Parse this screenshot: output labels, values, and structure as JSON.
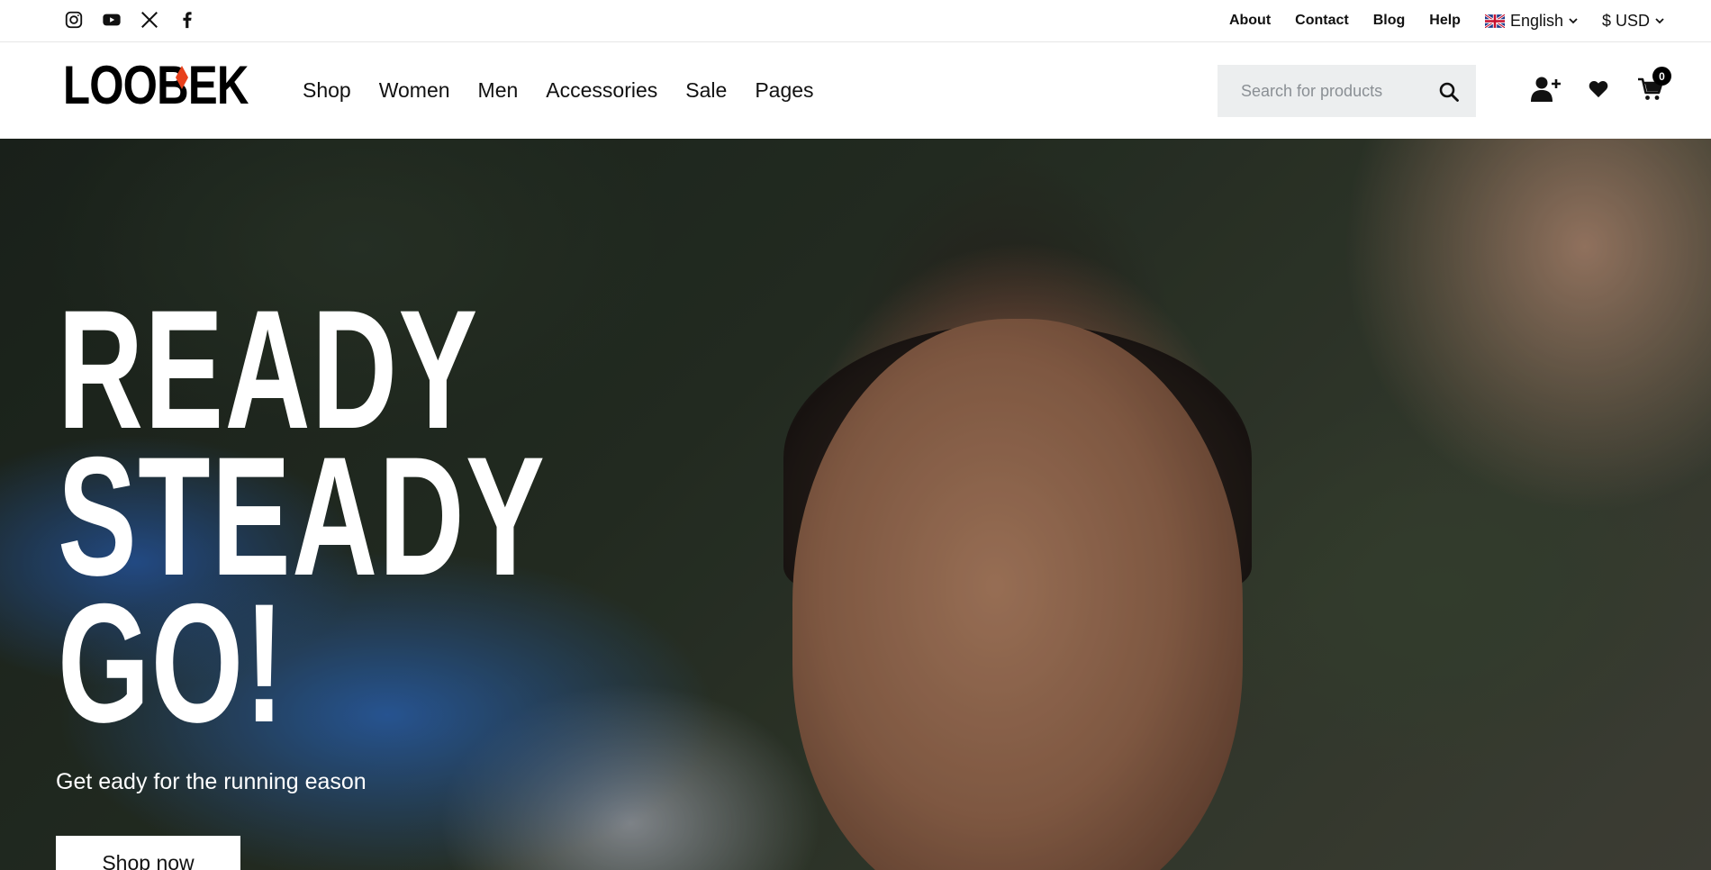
{
  "social": [
    "instagram-icon",
    "youtube-icon",
    "x-icon",
    "facebook-icon"
  ],
  "utility": {
    "links": [
      "About",
      "Contact",
      "Blog",
      "Help"
    ],
    "language": "English",
    "currency": "$ USD"
  },
  "brand": {
    "logo": "LOOBEK",
    "accent_color": "#e8401c"
  },
  "nav": [
    "Shop",
    "Women",
    "Men",
    "Accessories",
    "Sale",
    "Pages"
  ],
  "search": {
    "placeholder": "Search for products"
  },
  "cart": {
    "count": "0"
  },
  "hero": {
    "headline": [
      "READY",
      "STEADY",
      "GO!"
    ],
    "subtitle": "Get eady for the running eason",
    "cta": "Shop now"
  }
}
